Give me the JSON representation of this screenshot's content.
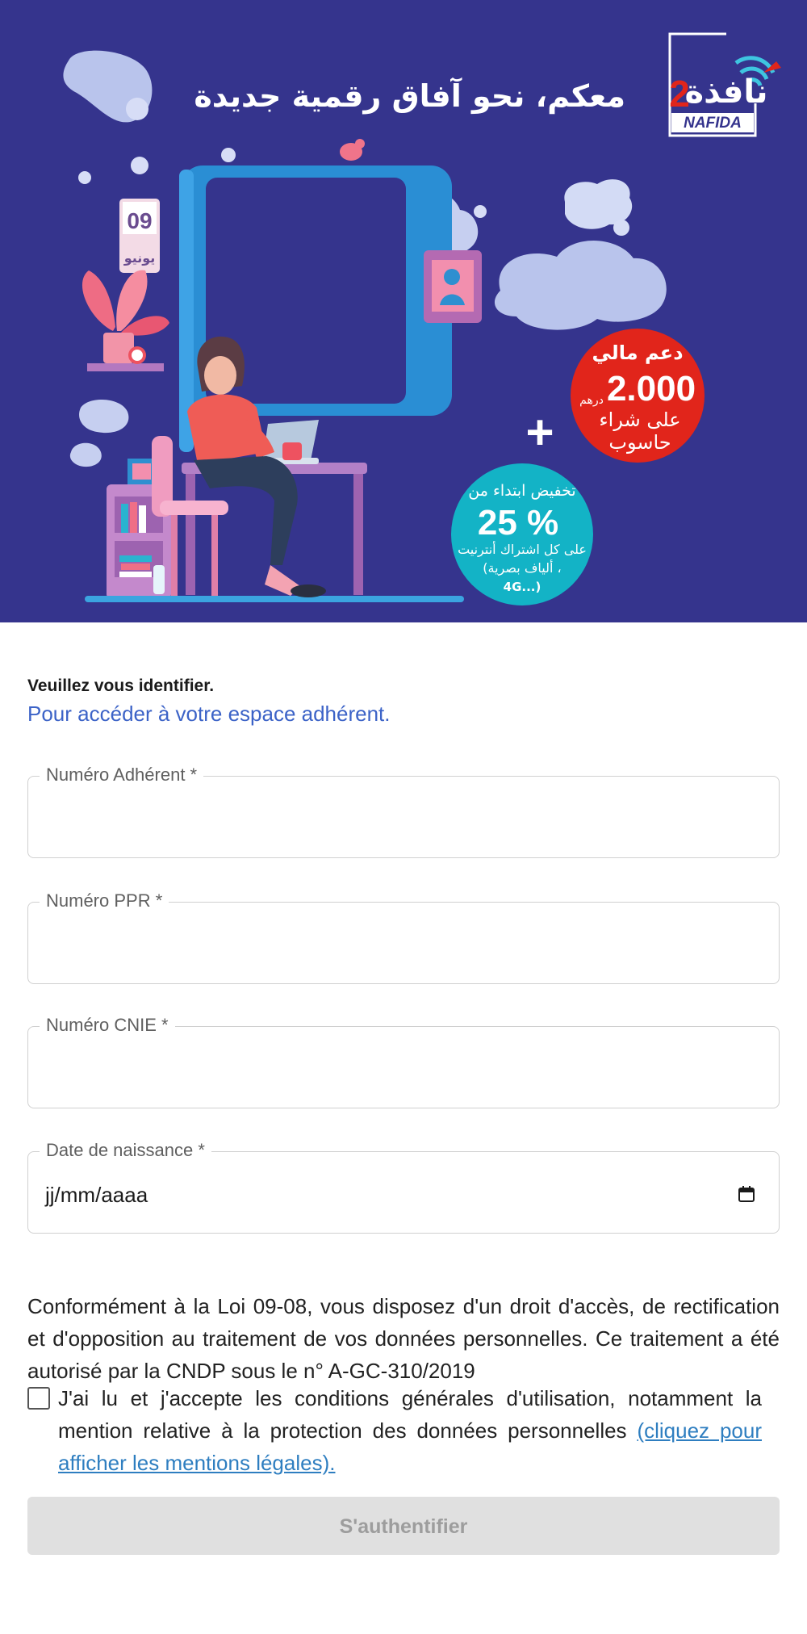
{
  "banner": {
    "headline": "معكم، نحو آفاق رقمية جديدة",
    "logo": {
      "arabic": "نافذة",
      "number": "2",
      "latin": "NAFIDA"
    },
    "calendar": {
      "day": "09",
      "month": "يونيو"
    },
    "red_badge": {
      "line1": "دعم مالي",
      "amount": "2.000",
      "currency": "درهم",
      "line3": "على شراء",
      "line4": "حاسوب"
    },
    "plus": "+",
    "teal_badge": {
      "line1": "تخفيض ابتداء من",
      "percent": "25 %",
      "line3": "على كل اشتراك أنترنيت",
      "line4": "(ألياف بصرية ،",
      "line5": "4G...)"
    },
    "colors": {
      "background": "#35348d",
      "red": "#e1251b",
      "teal": "#13b3c6"
    }
  },
  "intro": {
    "title": "Veuillez vous identifier.",
    "subtitle": "Pour accéder à votre espace adhérent."
  },
  "form": {
    "adherent": {
      "label": "Numéro Adhérent *",
      "value": ""
    },
    "ppr": {
      "label": "Numéro PPR *",
      "value": ""
    },
    "cnie": {
      "label": "Numéro CNIE *",
      "value": ""
    },
    "birthdate": {
      "label": "Date de naissance *",
      "placeholder": "jj/mm/aaaa",
      "icon": "calendar-icon"
    }
  },
  "legal_text": "Conformément à la Loi 09-08, vous disposez d'un droit d'accès, de rectification et d'opposition au traitement de vos données personnelles. Ce traitement a été autorisé par la CNDP sous le n° A-GC-310/2019",
  "consent": {
    "checked": false,
    "text": "J'ai lu et j'accepte les conditions générales d'utilisation, notamment la mention relative à la protection des données personnelles",
    "link": "(cliquez pour afficher les mentions légales)."
  },
  "submit_label": "S'authentifier"
}
